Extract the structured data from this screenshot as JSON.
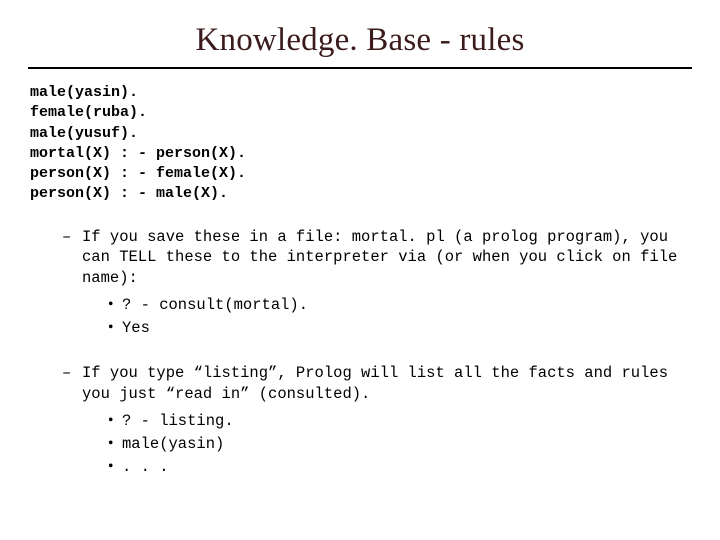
{
  "title": "Knowledge. Base - rules",
  "code": "male(yasin).\nfemale(ruba).\nmale(yusuf).\nmortal(X) : - person(X).\nperson(X) : - female(X).\nperson(X) : - male(X).",
  "items": [
    {
      "text": "If you save these in a file: mortal. pl (a prolog program), you can TELL these to the interpreter via (or when you click on file name):",
      "sub": [
        "? - consult(mortal).",
        "Yes"
      ]
    },
    {
      "text": "If you type “listing”, Prolog will list all the facts and rules you just “read in” (consulted).",
      "sub": [
        "? - listing.",
        "male(yasin)",
        ". . ."
      ]
    }
  ]
}
